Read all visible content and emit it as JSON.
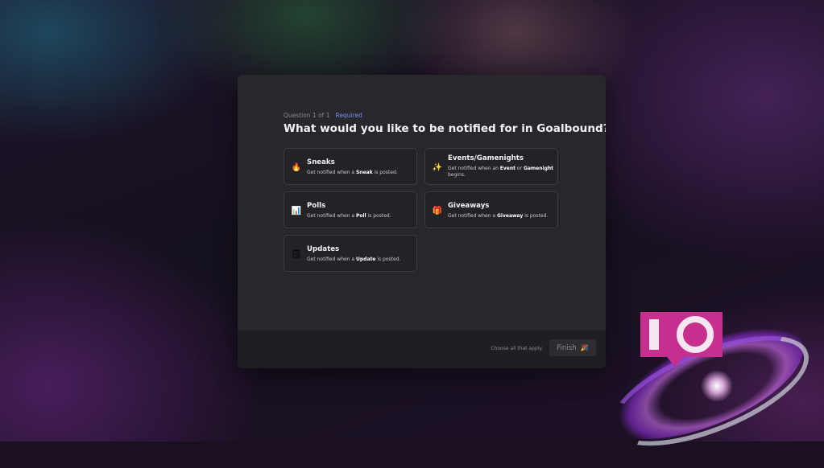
{
  "dialog": {
    "question_counter": "Question 1 of 1",
    "required_label": "Required",
    "title": "What would you like to be notified for in Goalbound?",
    "options": [
      {
        "icon": "fire-icon",
        "glyph": "🔥",
        "name": "Sneaks",
        "desc_pre": "Get notified when a ",
        "desc_bold": "Sneak",
        "desc_post": " is posted."
      },
      {
        "icon": "sparkles-icon",
        "glyph": "✨",
        "name": "Events/Gamenights",
        "desc_pre": "Get notified when an ",
        "desc_bold": "Event",
        "desc_mid": " or ",
        "desc_bold2": "Gamenight",
        "desc_post": " begins."
      },
      {
        "icon": "bar-chart-icon",
        "glyph": "📊",
        "name": "Polls",
        "desc_pre": "Get notified when a ",
        "desc_bold": "Poll",
        "desc_post": " is posted."
      },
      {
        "icon": "gift-icon",
        "glyph": "🎁",
        "name": "Giveaways",
        "desc_pre": "Get notified when a ",
        "desc_bold": "Giveaway",
        "desc_post": " is posted."
      },
      {
        "icon": "notepad-icon",
        "glyph": "🗒",
        "name": "Updates",
        "desc_pre": "Get notified when a ",
        "desc_bold": "Update",
        "desc_post": " is posted."
      }
    ],
    "choose_hint": "Choose all that apply.",
    "finish_label": "Finish",
    "finish_icon": "party-popper-icon"
  },
  "colors": {
    "accent": "#7e8cf5",
    "logo": "#c62f8e"
  }
}
